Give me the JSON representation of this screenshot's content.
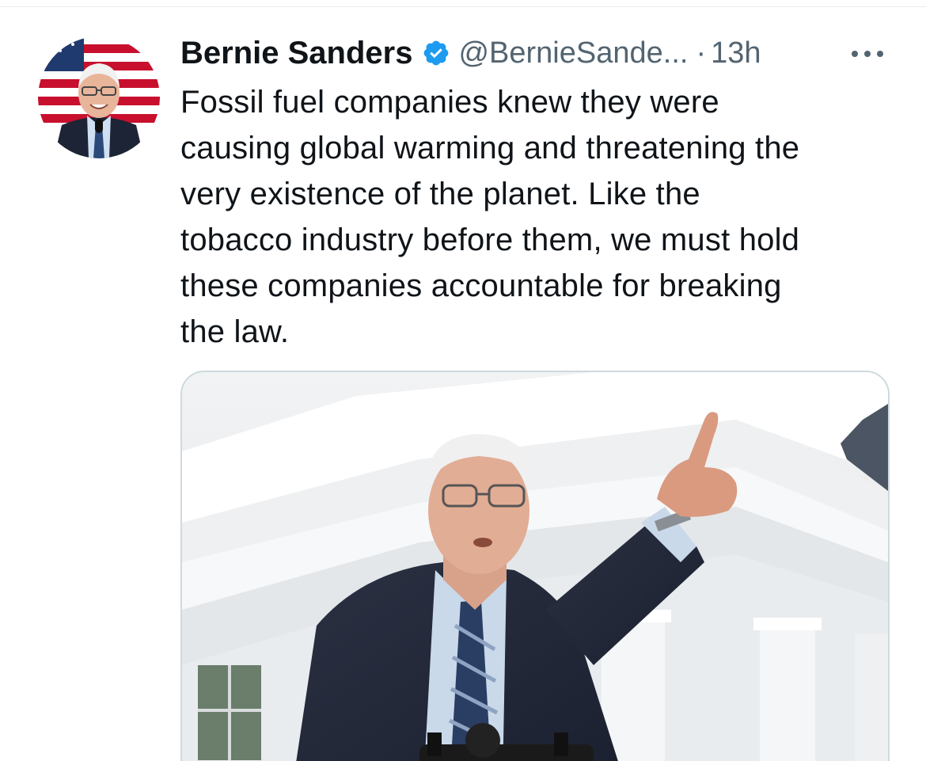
{
  "author": {
    "display_name": "Bernie Sanders",
    "handle": "@BernieSande...",
    "separator": "·",
    "time": "13h",
    "avatar_icon": "avatar-photo-icon",
    "verified_icon": "verified-badge-icon",
    "verified_color": "#1d9bf0"
  },
  "tweet": {
    "lines": [
      "Fossil fuel companies knew they were",
      "causing global warming and threatening the",
      "very existence of the planet. Like the",
      "tobacco industry before them, we must hold",
      "these companies accountable for breaking",
      "the law."
    ]
  },
  "menu": {
    "more_icon": "more-dots-icon"
  },
  "media": {
    "icon": "media-photo-icon"
  },
  "colors": {
    "text_primary": "#0f1419",
    "text_secondary": "#536471",
    "border": "#cfd9de"
  }
}
